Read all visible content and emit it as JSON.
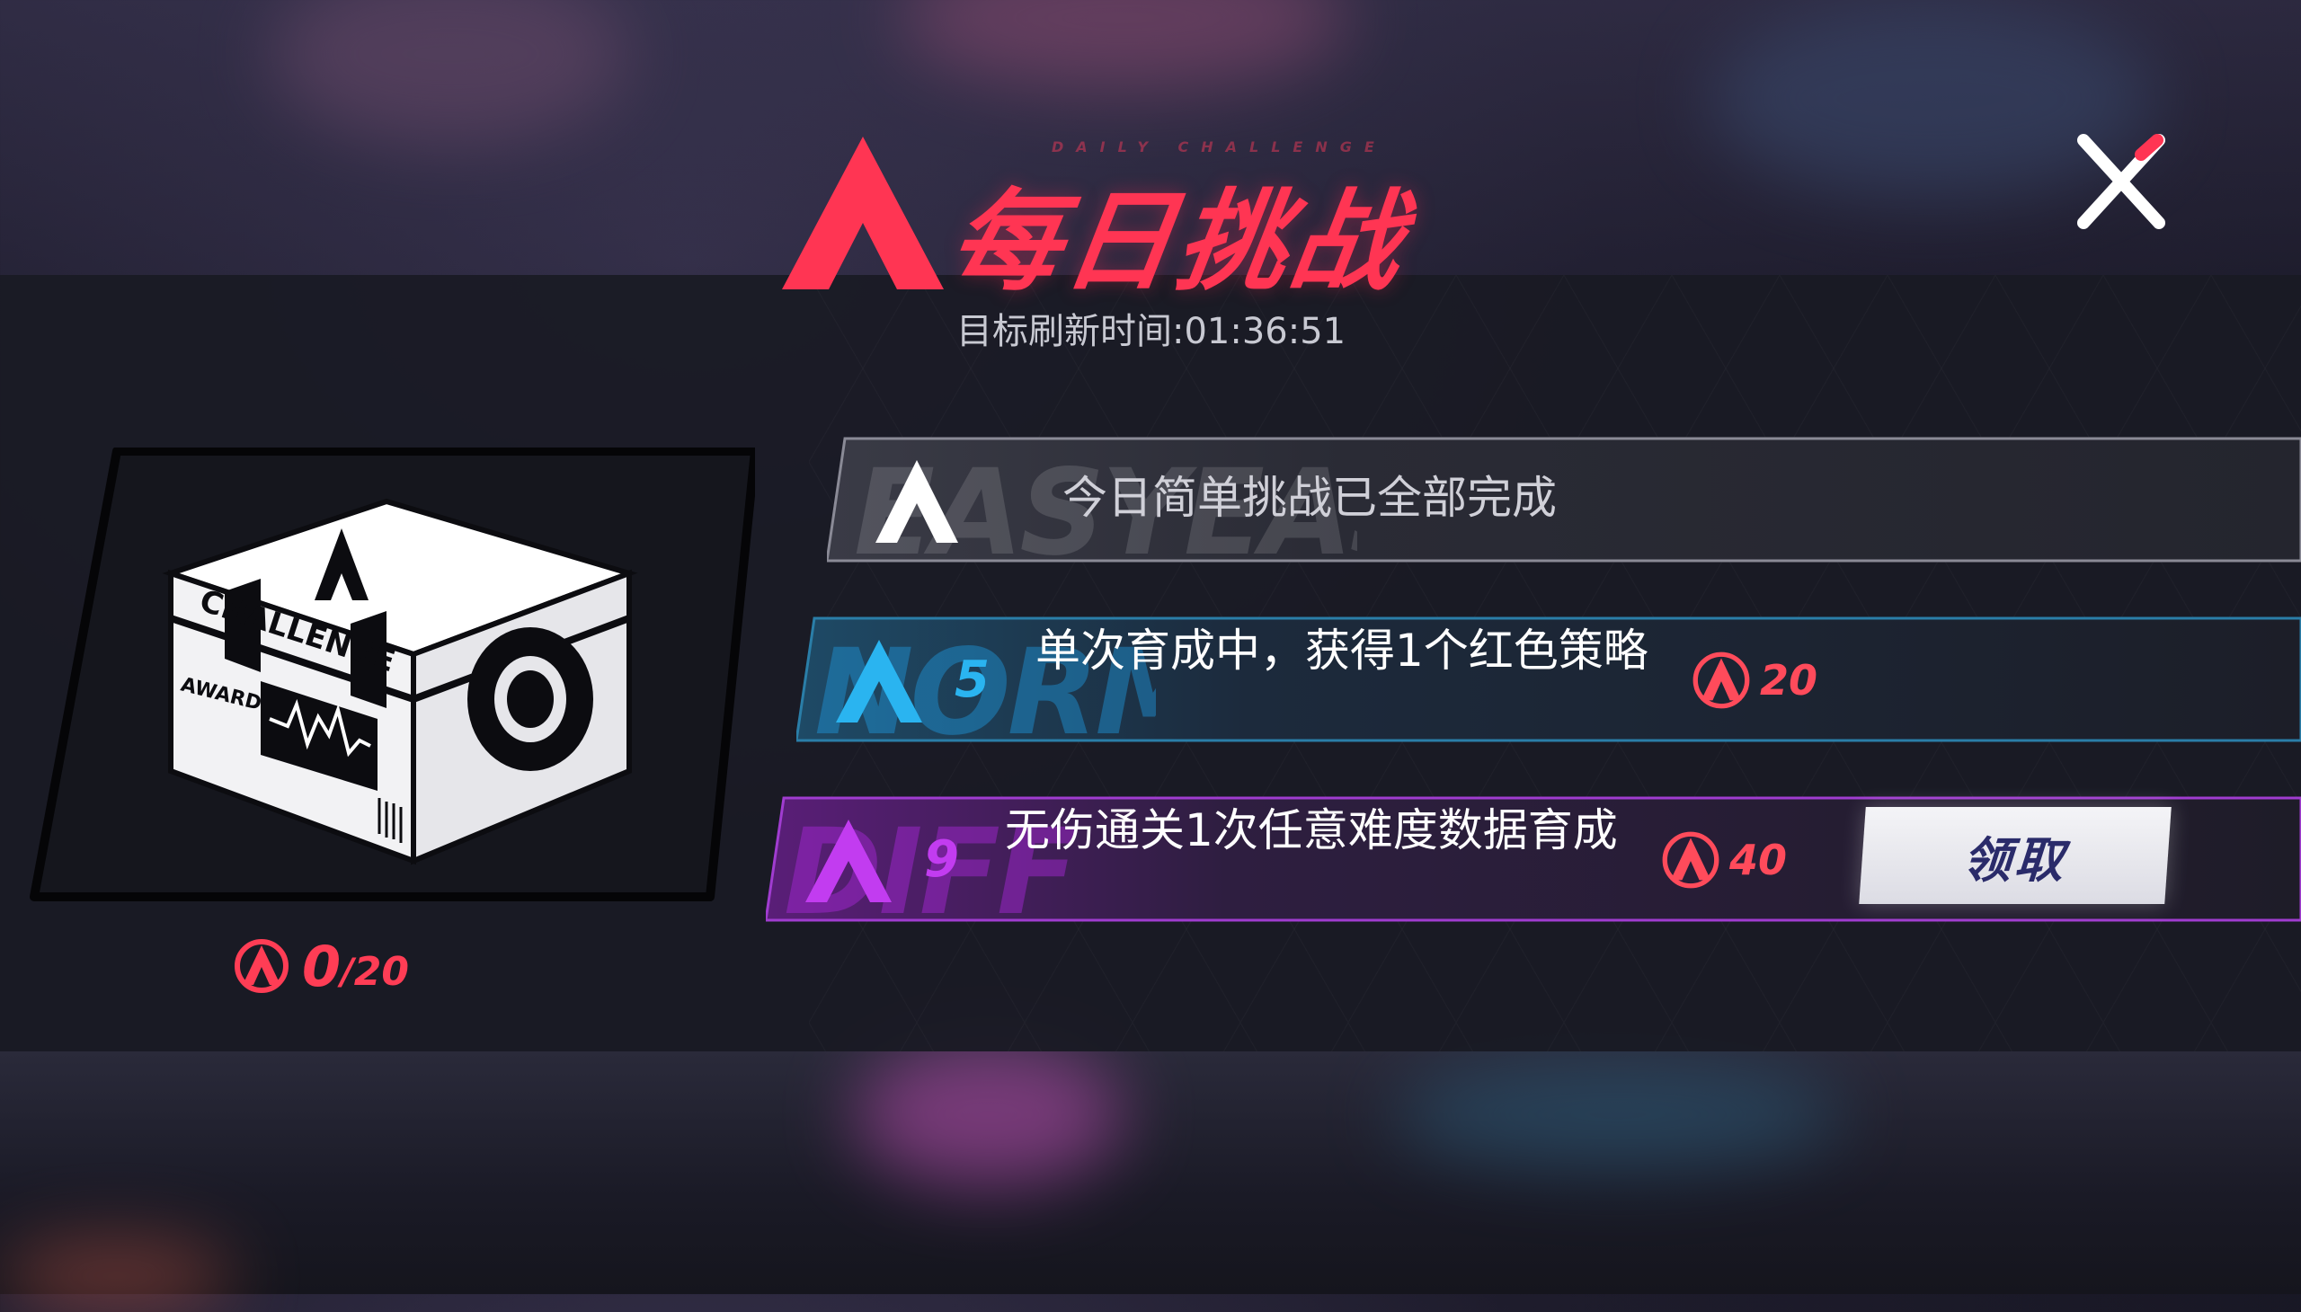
{
  "header": {
    "title": "每日挑战",
    "subtitle": "DAILY CHALLENGE",
    "refresh_text": "目标刷新时间:01:36:51"
  },
  "chest": {
    "icon": "challenge-chest-icon",
    "label_challenge": "CHALLENGE",
    "label_award": "AWARD",
    "progress_current": "0",
    "progress_sep": "/",
    "progress_max": "20"
  },
  "challenges": [
    {
      "watermark": "EASYEASY",
      "description": "今日简单挑战已全部完成",
      "accent": "#ffffff"
    },
    {
      "watermark": "NORMAL",
      "level": "5",
      "description": "单次育成中，获得1个红色策略",
      "reward": "20",
      "accent": "#2ab4f0"
    },
    {
      "watermark": "DIFF",
      "level": "9",
      "description": "无伤通关1次任意难度数据育成",
      "reward": "40",
      "accent": "#c23cf0",
      "button_label": "领取"
    }
  ],
  "colors": {
    "title_red": "#ff3553",
    "reward_red": "#ff4b5b",
    "normal_blue": "#2ab4f0",
    "hard_purple": "#c23cf0",
    "panel": "#1a1b24"
  }
}
